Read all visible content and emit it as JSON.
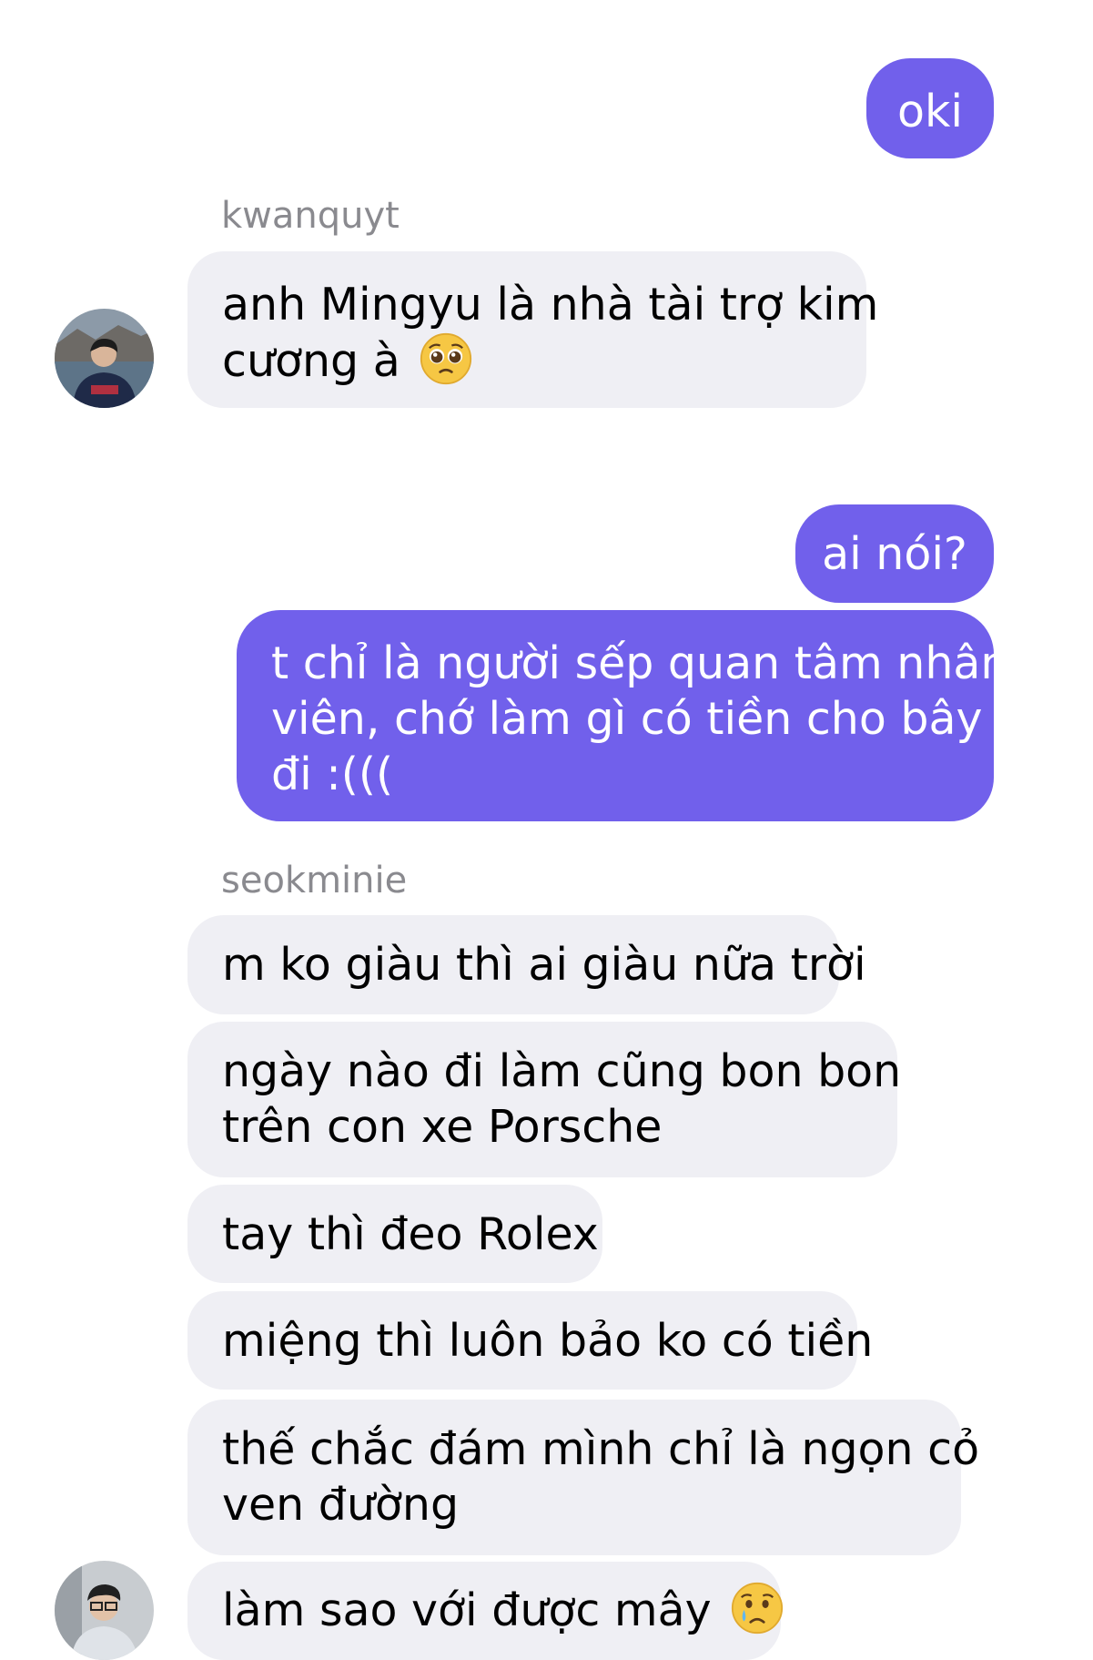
{
  "messages": [
    {
      "sender": "me",
      "text": "oki"
    },
    {
      "sender": "kwanquyt",
      "username": "kwanquyt",
      "line1": "anh Mingyu là nhà tài trợ kim",
      "line2": "cương à",
      "emoji": "pleading-face"
    },
    {
      "sender": "me",
      "text": "ai nói?"
    },
    {
      "sender": "me",
      "line1": "t chỉ là người sếp quan tâm nhân",
      "line2": "viên, chớ làm gì có tiền cho bây",
      "line3": "đi :((("
    },
    {
      "sender": "seokminie",
      "username": "seokminie",
      "text": "m ko giàu thì ai giàu nữa trời"
    },
    {
      "sender": "seokminie",
      "line1": "ngày nào đi làm cũng bon bon",
      "line2": "trên con xe Porsche"
    },
    {
      "sender": "seokminie",
      "text": "tay thì đeo Rolex"
    },
    {
      "sender": "seokminie",
      "text": "miệng thì luôn bảo ko có tiền"
    },
    {
      "sender": "seokminie",
      "line1": "thế chắc đám mình chỉ là ngọn cỏ",
      "line2": "ven đường"
    },
    {
      "sender": "seokminie",
      "text": "làm sao với được mây",
      "emoji": "crying-face"
    }
  ],
  "colors": {
    "outgoing_bubble": "#7160eb",
    "incoming_bubble": "#efeff4",
    "username_text": "#8a8a8f"
  }
}
